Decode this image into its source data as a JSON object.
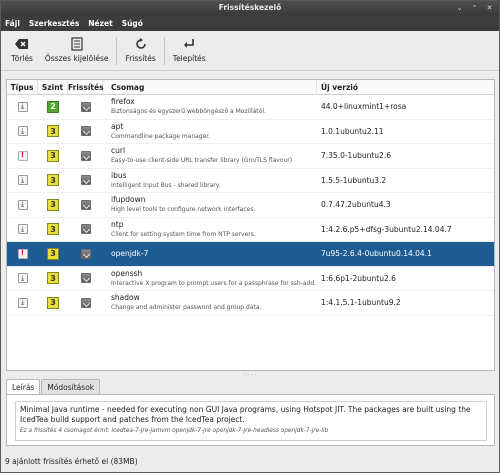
{
  "window": {
    "title": "Frissítéskezelő",
    "controls": [
      "⌄",
      "⌃",
      "✕"
    ]
  },
  "menu": [
    "Fájl",
    "Szerkesztés",
    "Nézet",
    "Súgó"
  ],
  "toolbar": {
    "clear": "Törlés",
    "select_all": "Összes kijelölése",
    "refresh": "Frissítés",
    "install": "Telepítés"
  },
  "columns": {
    "type": "Típus",
    "level": "Szint",
    "update": "Frissítés",
    "package": "Csomag",
    "new_version": "Új verzió"
  },
  "packages": [
    {
      "type": "normal",
      "level": "2",
      "name": "firefox",
      "desc": "Biztonságos és egyszerű webböngésző a Mozillától.",
      "version": "44.0+linuxmint1+rosa"
    },
    {
      "type": "normal",
      "level": "3",
      "name": "apt",
      "desc": "Commandline package manager.",
      "version": "1.0.1ubuntu2.11"
    },
    {
      "type": "security",
      "level": "3",
      "name": "curl",
      "desc": "Easy-to-use client-side URL transfer library (GnuTLS flavour)",
      "version": "7.35.0-1ubuntu2.6"
    },
    {
      "type": "normal",
      "level": "3",
      "name": "ibus",
      "desc": "Intelligent Input Bus - shared library.",
      "version": "1.5.5-1ubuntu3.2"
    },
    {
      "type": "normal",
      "level": "3",
      "name": "ifupdown",
      "desc": "High level tools to configure network interfaces.",
      "version": "0.7.47.2ubuntu4.3"
    },
    {
      "type": "normal",
      "level": "3",
      "name": "ntp",
      "desc": "Client for setting system time from NTP servers.",
      "version": "1:4.2.6.p5+dfsg-3ubuntu2.14.04.7"
    },
    {
      "type": "security",
      "level": "3",
      "name": "openjdk-7",
      "desc": "",
      "version": "7u95-2.6.4-0ubuntu0.14.04.1",
      "selected": true
    },
    {
      "type": "normal",
      "level": "3",
      "name": "openssh",
      "desc": "Interactive X program to prompt users for a passphrase for ssh-add.",
      "version": "1:6.6p1-2ubuntu2.6"
    },
    {
      "type": "normal",
      "level": "3",
      "name": "shadow",
      "desc": "Change and administer password and group data.",
      "version": "1:4.1.5.1-1ubuntu9.2"
    }
  ],
  "bottom_tabs": {
    "description": "Leírás",
    "changes": "Módosítások"
  },
  "description": {
    "main": "Minimal Java runtime - needed for executing non GUI Java programs, using Hotspot JIT. The packages are built using the IcedTea build support and patches from the IcedTea project.",
    "affected": "Ez a frissítés 4 csomagot érint:  icedtea-7-jre-jamvm openjdk-7-jre openjdk-7-jre-headless openjdk-7-jre-lib"
  },
  "status": "9 ajánlott frissítés érhető el (83MB)",
  "colors": {
    "selection": "#1d5c93",
    "level2": "#51a532",
    "level3": "#e8df3a",
    "security_mark": "#c8131b"
  }
}
